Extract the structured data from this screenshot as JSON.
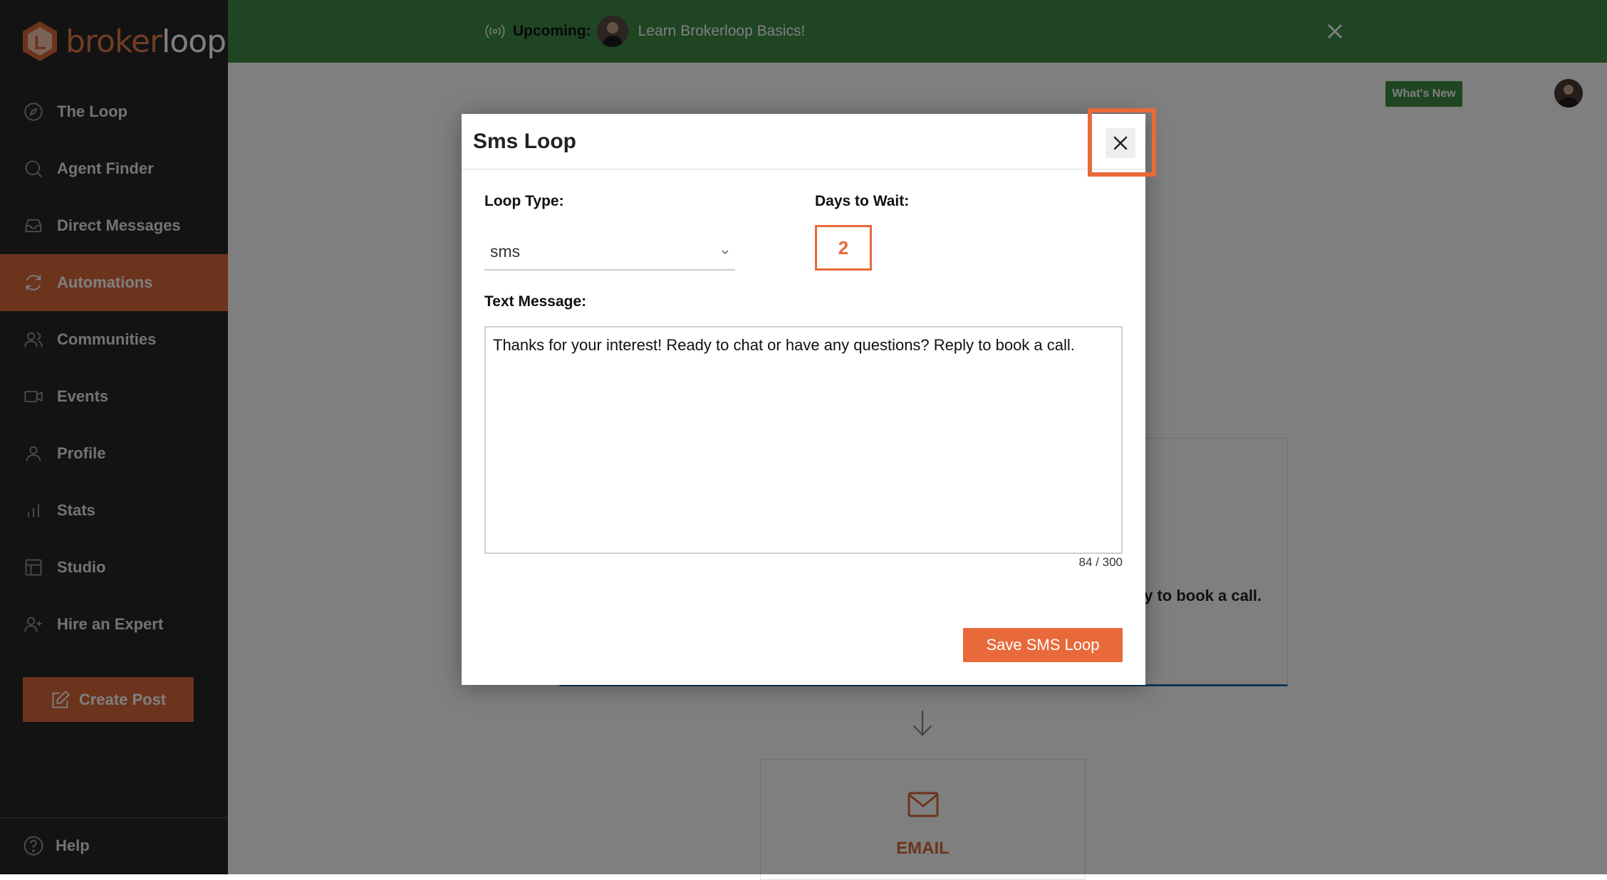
{
  "brand": {
    "name_part1": "broker",
    "name_part2": "loop",
    "accent_color": "#d9693b"
  },
  "sidebar": {
    "items": [
      {
        "label": "The Loop",
        "icon": "compass-icon"
      },
      {
        "label": "Agent Finder",
        "icon": "search-icon"
      },
      {
        "label": "Direct Messages",
        "icon": "inbox-icon"
      },
      {
        "label": "Automations",
        "icon": "refresh-icon",
        "active": true
      },
      {
        "label": "Communities",
        "icon": "users-icon"
      },
      {
        "label": "Events",
        "icon": "video-icon"
      },
      {
        "label": "Profile",
        "icon": "user-icon"
      },
      {
        "label": "Stats",
        "icon": "bar-chart-icon"
      },
      {
        "label": "Studio",
        "icon": "layout-icon"
      },
      {
        "label": "Hire an Expert",
        "icon": "user-plus-icon"
      }
    ],
    "create_post": "Create Post",
    "help": "Help"
  },
  "banner": {
    "prefix": "Upcoming:",
    "title": "Learn Brokerloop Basics!",
    "color": "#3f8a47"
  },
  "header": {
    "whats_new": "What's New"
  },
  "background": {
    "card_text": "ly to book a call.",
    "email_label": "EMAIL"
  },
  "modal": {
    "title": "Sms Loop",
    "loop_type_label": "Loop Type:",
    "loop_type_value": "sms",
    "days_label": "Days to Wait:",
    "days_value": "2",
    "text_label": "Text Message:",
    "text_value": "Thanks for your interest! Ready to chat or have any questions? Reply to book a call.",
    "counter": "84 / 300",
    "save_button": "Save SMS Loop",
    "highlight_color": "#e8693a"
  }
}
